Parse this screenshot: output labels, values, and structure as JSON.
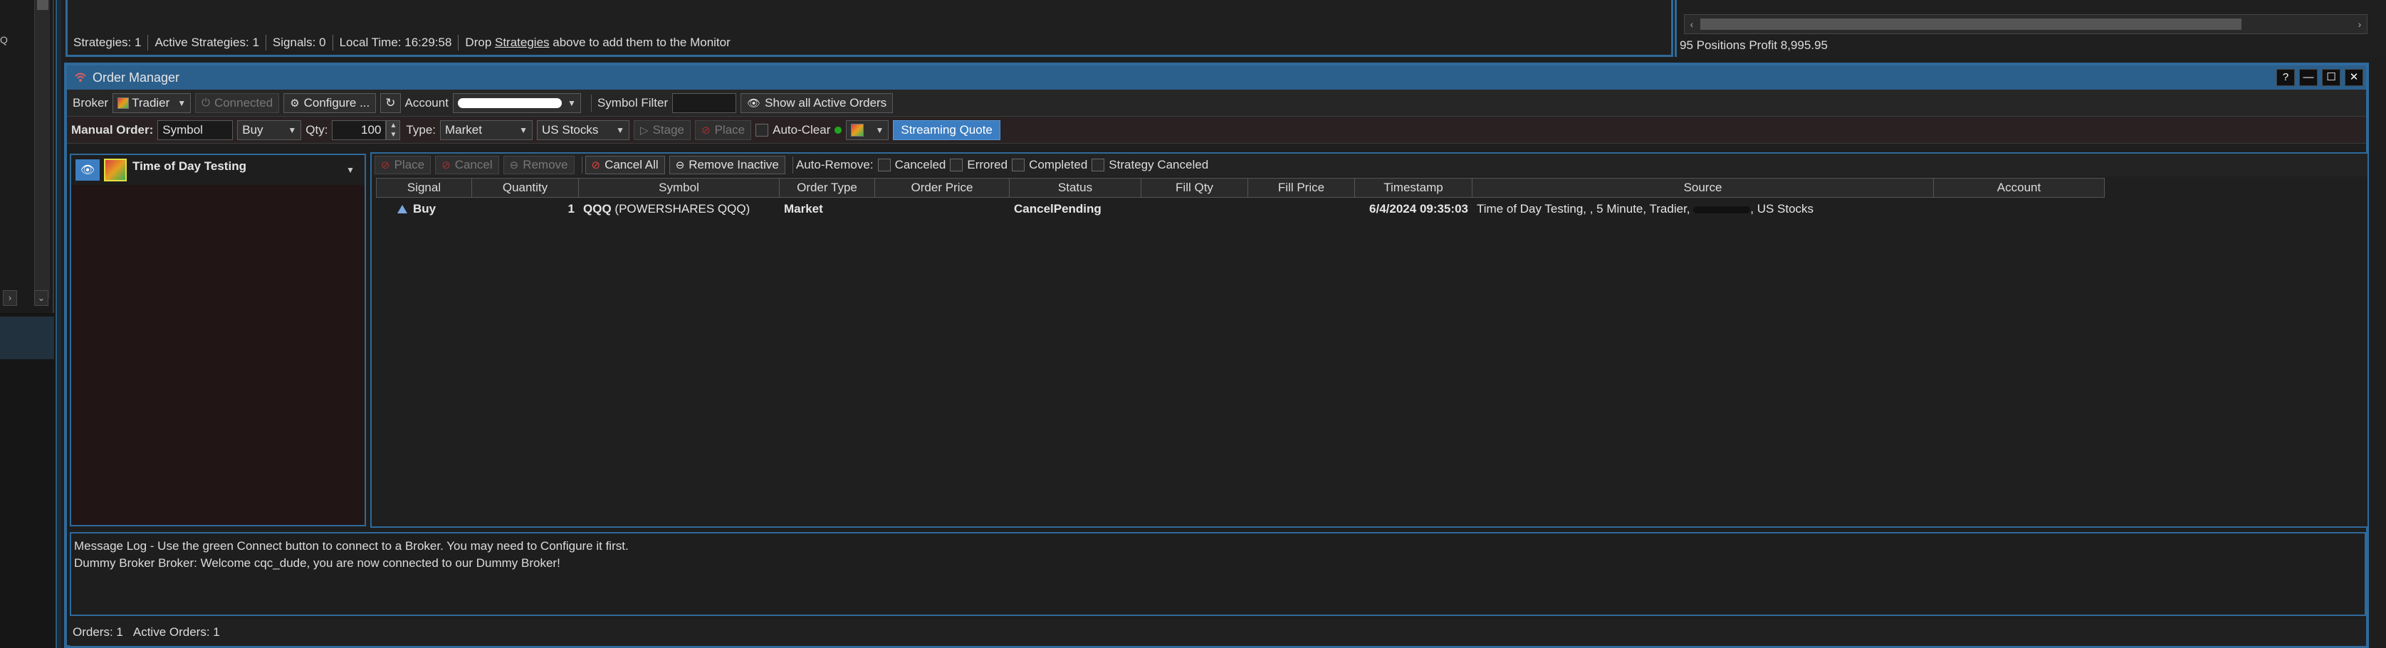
{
  "top_status": {
    "strategies": "Strategies: 1",
    "active_strategies": "Active Strategies: 1",
    "signals": "Signals: 0",
    "local_time": "Local Time: 16:29:58",
    "drop_prefix": "Drop ",
    "drop_link": "Strategies",
    "drop_suffix": " above to add them to the Monitor"
  },
  "positions_profit": "95  Positions Profit 8,995.95",
  "left_edge_text": "Q",
  "order_manager": {
    "title": "Order Manager",
    "window_buttons": [
      "?",
      "—",
      "☐",
      "✕"
    ],
    "toolbar1": {
      "broker_label": "Broker",
      "broker_value": "Tradier",
      "connected_label": "Connected",
      "configure_label": "Configure ...",
      "account_label": "Account",
      "symbol_filter_label": "Symbol Filter",
      "symbol_filter_value": "",
      "show_all_label": "Show all Active Orders"
    },
    "toolbar2": {
      "manual_order_label": "Manual Order:",
      "symbol_placeholder": "Symbol",
      "side_value": "Buy",
      "qty_label": "Qty:",
      "qty_value": "100",
      "type_label": "Type:",
      "type_value": "Market",
      "market_value": "US Stocks",
      "stage_label": "Stage",
      "place_label": "Place",
      "auto_clear_label": "Auto-Clear",
      "streaming_quote_label": "Streaming Quote"
    },
    "strategy": {
      "name": "Time of Day Testing"
    },
    "orders_toolbar": {
      "place_label": "Place",
      "cancel_label": "Cancel",
      "remove_label": "Remove",
      "cancel_all_label": "Cancel All",
      "remove_inactive_label": "Remove Inactive",
      "auto_remove_label": "Auto-Remove:",
      "canceled_label": "Canceled",
      "errored_label": "Errored",
      "completed_label": "Completed",
      "strategy_canceled_label": "Strategy Canceled"
    },
    "columns": [
      "Signal",
      "Quantity",
      "Symbol",
      "Order Type",
      "Order Price",
      "Status",
      "Fill Qty",
      "Fill Price",
      "Timestamp",
      "Source",
      "Account"
    ],
    "orders": [
      {
        "signal": "Buy",
        "quantity": "1",
        "symbol": "QQQ",
        "symbol_desc": "(POWERSHARES QQQ)",
        "order_type": "Market",
        "order_price": "",
        "status": "CancelPending",
        "fill_qty": "",
        "fill_price": "",
        "timestamp": "6/4/2024 09:35:03",
        "source_prefix": "Time of Day Testing, , 5 Minute, Tradier, ",
        "source_suffix": ", US Stocks",
        "account": ""
      }
    ],
    "message_log": [
      "Message Log - Use the green Connect button to connect to a Broker. You may need to Configure it first.",
      "Dummy Broker Broker: Welcome cqc_dude, you are now connected to our Dummy Broker!"
    ],
    "status": {
      "orders": "Orders: 1",
      "active_orders": "Active Orders: 1"
    }
  },
  "colors": {
    "accent_blue": "#2f6a9b",
    "streaming_blue": "#3d7ec2",
    "connect_green": "#1fa81f"
  }
}
